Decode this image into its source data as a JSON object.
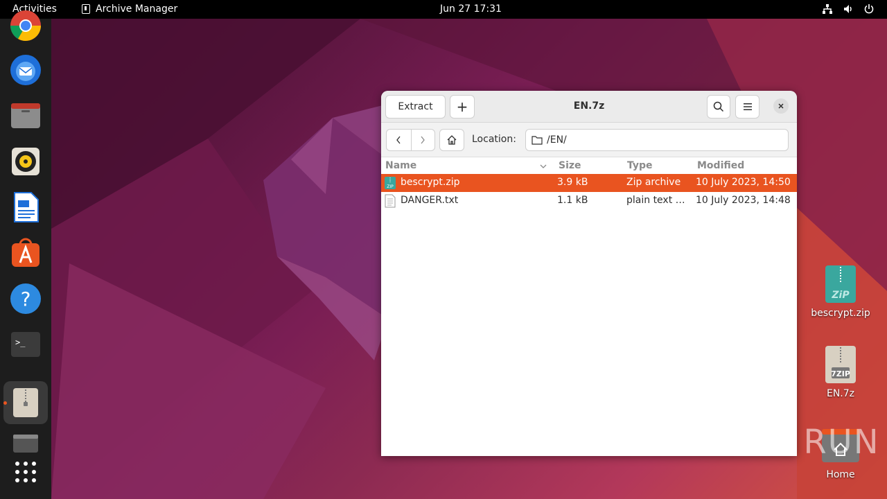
{
  "topbar": {
    "activities": "Activities",
    "app_name": "Archive Manager",
    "clock": "Jun 27  17:31",
    "tray_icons": [
      "network-icon",
      "volume-icon",
      "power-icon"
    ]
  },
  "dock": {
    "apps": [
      "chrome",
      "thunderbird",
      "files",
      "rhythmbox",
      "libreoffice-writer",
      "software",
      "help",
      "terminal",
      "archive-manager",
      "disk",
      "app-grid"
    ],
    "active_app": "archive-manager"
  },
  "window": {
    "title": "EN.7z",
    "extract_label": "Extract",
    "add_label": "+",
    "location_label": "Location:",
    "location_value": "/EN/",
    "columns": {
      "name": "Name",
      "size": "Size",
      "type": "Type",
      "modified": "Modified"
    },
    "files": [
      {
        "name": "bescrypt.zip",
        "size": "3.9 kB",
        "type": "Zip archive",
        "modified": "10 July 2023, 14:50",
        "selected": true,
        "icon": "zip-icon"
      },
      {
        "name": "DANGER.txt",
        "size": "1.1 kB",
        "type": "plain text …",
        "modified": "10 July 2023, 14:48",
        "selected": false,
        "icon": "text-file-icon"
      }
    ]
  },
  "desktop": {
    "icons": [
      {
        "label": "bescrypt.zip",
        "icon": "zip-file-icon"
      },
      {
        "label": "EN.7z",
        "icon": "7zip-file-icon"
      },
      {
        "label": "Home",
        "icon": "home-folder-icon"
      }
    ]
  },
  "watermark": "ANY RUN",
  "colors": {
    "accent": "#e95420",
    "topbar": "#000000",
    "dock": "#1d1d1d"
  }
}
